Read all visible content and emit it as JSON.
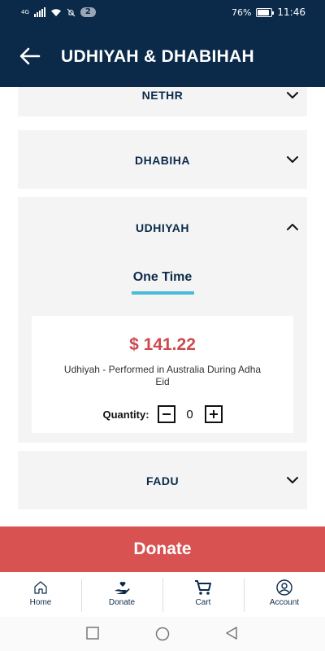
{
  "status_bar": {
    "network": "4G",
    "notification_count": "2",
    "battery": "76%",
    "time": "11:46"
  },
  "header": {
    "title": "UDHIYAH & DHABIHAH",
    "back_icon": "arrow-left-icon"
  },
  "sections": [
    {
      "title": "NETHR",
      "expanded": false
    },
    {
      "title": "DHABIHA",
      "expanded": false
    },
    {
      "title": "UDHIYAH",
      "expanded": true
    },
    {
      "title": "FADU",
      "expanded": false
    }
  ],
  "udhiyah": {
    "tab_label": "One Time",
    "product": {
      "price": "$ 141.22",
      "description": "Udhiyah - Performed in Australia During Adha Eid",
      "quantity_label": "Quantity:",
      "quantity": "0"
    }
  },
  "donate_button": "Donate",
  "bottom_nav": [
    {
      "label": "Home",
      "icon": "home-icon"
    },
    {
      "label": "Donate",
      "icon": "donate-hand-icon"
    },
    {
      "label": "Cart",
      "icon": "cart-icon"
    },
    {
      "label": "Account",
      "icon": "account-icon"
    }
  ],
  "colors": {
    "primary": "#0b2a4a",
    "accent": "#4bbbdc",
    "price": "#cc4a4f",
    "donate": "#d95252",
    "panel": "#f4f4f4"
  }
}
